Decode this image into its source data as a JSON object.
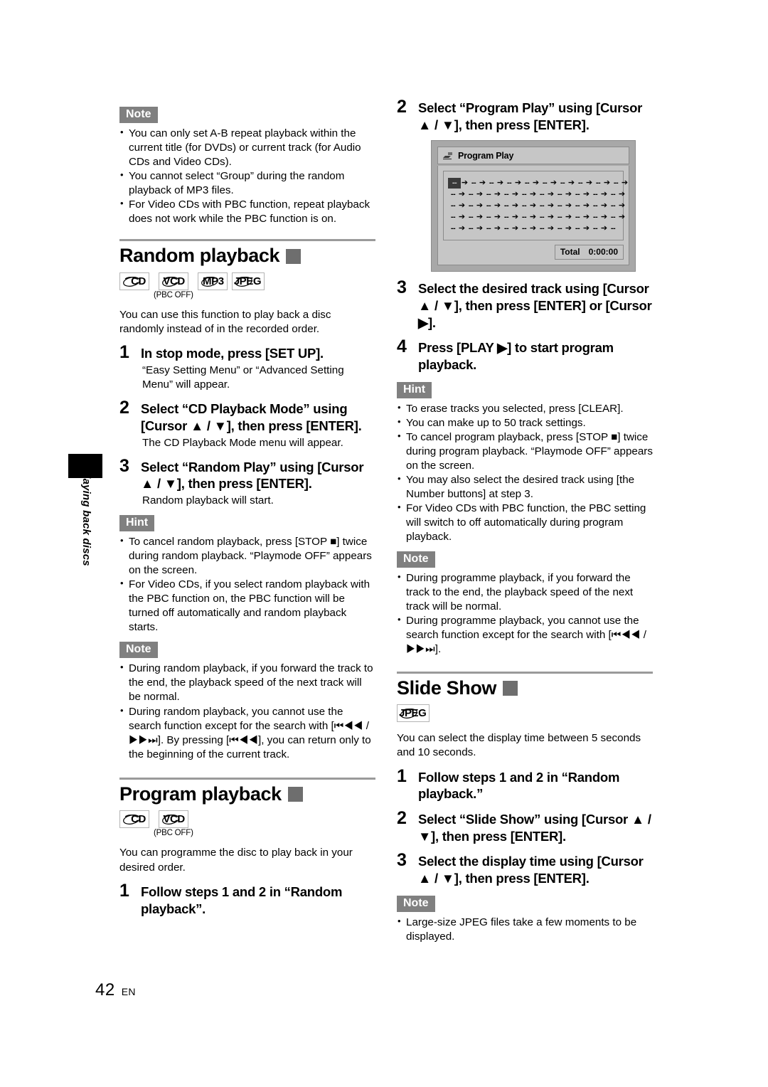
{
  "page": {
    "number": "42",
    "lang": "EN",
    "side_tab_label": "Playing back discs"
  },
  "labels": {
    "note": "Note",
    "hint": "Hint"
  },
  "left_column": {
    "note_top": {
      "badge": "Note",
      "items": [
        "You can only set A-B repeat playback within the current title (for DVDs) or current track (for Audio CDs and Video CDs).",
        "You cannot select “Group” during the random playback of MP3 files.",
        "For Video CDs with PBC function, repeat playback does not work while the PBC function is on."
      ]
    },
    "random_section": {
      "title": "Random playback",
      "disc_icons": [
        {
          "label": "CD",
          "sub": ""
        },
        {
          "label": "VCD",
          "sub": "(PBC OFF)"
        },
        {
          "label": "MP3",
          "sub": ""
        },
        {
          "label": "JPEG",
          "sub": ""
        }
      ],
      "intro": "You can use this function to play back a disc randomly instead of in the recorded order.",
      "steps": [
        {
          "num": "1",
          "text": "In stop mode, press [SET UP].",
          "sub": "“Easy Setting Menu” or “Advanced Setting Menu” will appear."
        },
        {
          "num": "2",
          "text": "Select “CD Playback Mode” using [Cursor ▲ / ▼], then press [ENTER].",
          "sub": "The CD Playback Mode menu will appear."
        },
        {
          "num": "3",
          "text": "Select “Random Play” using [Cursor ▲ / ▼], then press [ENTER].",
          "sub": "Random playback will start."
        }
      ],
      "hint": {
        "badge": "Hint",
        "items": [
          "To cancel random playback, press [STOP ■] twice during random playback. “Playmode OFF” appears on the screen.",
          "For Video CDs, if you select random playback with the PBC function on, the PBC function will be turned off automatically and random playback starts."
        ]
      },
      "note": {
        "badge": "Note",
        "items": [
          "During random playback, if you forward the track to the end, the playback speed of the next track will be normal.",
          "During random playback, you cannot use the search function except for the search with [⏮◀◀ / ▶▶⏭]. By pressing [⏮◀◀], you can return only to the beginning of the current track."
        ]
      }
    },
    "program_section": {
      "title": "Program playback",
      "disc_icons": [
        {
          "label": "CD",
          "sub": ""
        },
        {
          "label": "VCD",
          "sub": "(PBC OFF)"
        }
      ],
      "intro": "You can programme the disc to play back in your desired order.",
      "steps": [
        {
          "num": "1",
          "text": "Follow steps 1 and 2 in “Random playback”.",
          "sub": ""
        }
      ]
    }
  },
  "right_column": {
    "program_steps_top": [
      {
        "num": "2",
        "text": "Select “Program Play” using [Cursor ▲ / ▼], then press [ENTER].",
        "sub": ""
      }
    ],
    "osd": {
      "title": "Program Play",
      "icon": "disc-arrow-icon",
      "rows": 5,
      "slots_per_row": 10,
      "slot_placeholder": "--",
      "arrow": "➔",
      "cursor_index": 0,
      "total_label": "Total",
      "total_value": "0:00:00"
    },
    "program_steps_bottom": [
      {
        "num": "3",
        "text": "Select the desired track using [Cursor ▲ / ▼], then press [ENTER] or [Cursor ▶].",
        "sub": ""
      },
      {
        "num": "4",
        "text": "Press [PLAY ▶] to start program playback.",
        "sub": ""
      }
    ],
    "hint": {
      "badge": "Hint",
      "items": [
        "To erase tracks you selected, press [CLEAR].",
        "You can make up to 50 track settings.",
        "To cancel program playback, press [STOP ■] twice during program playback. “Playmode OFF” appears on the screen.",
        "You may also select the desired track using [the Number buttons] at step 3.",
        "For Video CDs with PBC function, the PBC setting will switch to off automatically during program playback."
      ]
    },
    "note": {
      "badge": "Note",
      "items": [
        "During programme playback, if you forward the track to the end, the playback speed of the next track will be normal.",
        "During programme playback, you cannot use the search function except for the search with [⏮◀◀ / ▶▶⏭]."
      ]
    },
    "slideshow_section": {
      "title": "Slide Show",
      "disc_icons": [
        {
          "label": "JPEG",
          "sub": ""
        }
      ],
      "intro": "You can select the display time between 5 seconds and 10 seconds.",
      "steps": [
        {
          "num": "1",
          "text": "Follow steps 1 and 2 in “Random playback.”",
          "sub": ""
        },
        {
          "num": "2",
          "text": "Select “Slide Show” using [Cursor ▲ / ▼], then press [ENTER].",
          "sub": ""
        },
        {
          "num": "3",
          "text": "Select the display time using [Cursor ▲ / ▼], then press [ENTER].",
          "sub": ""
        }
      ],
      "note": {
        "badge": "Note",
        "items": [
          "Large-size JPEG files take a few moments to be displayed."
        ]
      }
    }
  },
  "colors": {
    "badge_bg": "#808080",
    "section_square": "#6e6e6e",
    "rule": "#9a9a9a",
    "osd_frame": "#a8a8a8",
    "osd_panel": "#c6c6c6"
  }
}
